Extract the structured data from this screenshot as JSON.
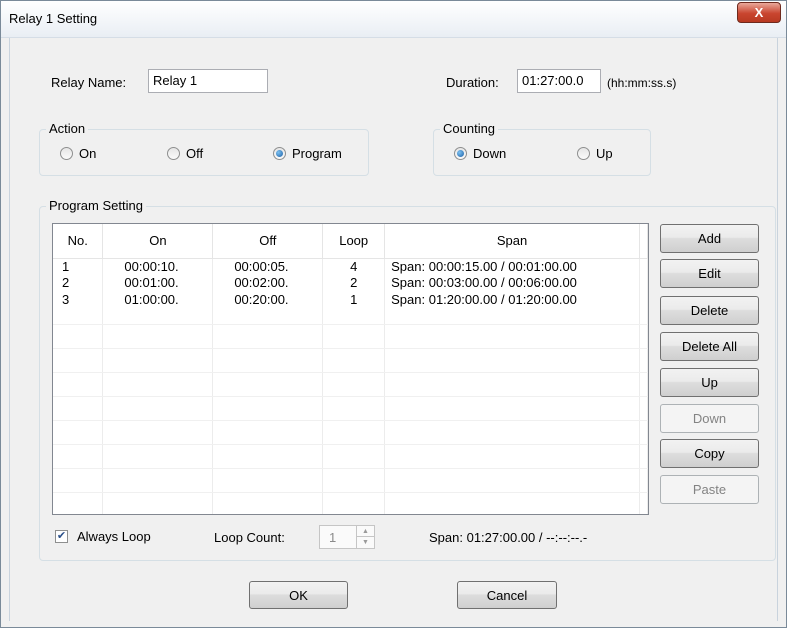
{
  "window": {
    "title": "Relay 1 Setting",
    "close_glyph": "X"
  },
  "relay_name": {
    "label": "Relay Name:",
    "value": "Relay 1"
  },
  "duration": {
    "label": "Duration:",
    "value": "01:27:00.0",
    "format": "(hh:mm:ss.s)"
  },
  "action": {
    "label": "Action",
    "options": [
      {
        "label": "On",
        "checked": false
      },
      {
        "label": "Off",
        "checked": false
      },
      {
        "label": "Program",
        "checked": true
      }
    ]
  },
  "counting": {
    "label": "Counting",
    "options": [
      {
        "label": "Down",
        "checked": true
      },
      {
        "label": "Up",
        "checked": false
      }
    ]
  },
  "program": {
    "label": "Program Setting",
    "columns": [
      "No.",
      "On",
      "Off",
      "Loop",
      "Span"
    ],
    "rows": [
      [
        "1",
        "00:00:10.",
        "00:00:05.",
        "4",
        "Span: 00:00:15.00 / 00:01:00.00"
      ],
      [
        "2",
        "00:01:00.",
        "00:02:00.",
        "2",
        "Span: 00:03:00.00 / 00:06:00.00"
      ],
      [
        "3",
        "01:00:00.",
        "00:20:00.",
        "1",
        "Span: 01:20:00.00 / 01:20:00.00"
      ]
    ],
    "buttons": {
      "add": "Add",
      "edit": "Edit",
      "delete": "Delete",
      "delete_all": "Delete All",
      "up": "Up",
      "down": "Down",
      "copy": "Copy",
      "paste": "Paste"
    }
  },
  "always_loop": {
    "label": "Always Loop",
    "checked": true
  },
  "loop_count": {
    "label": "Loop Count:",
    "value": "1"
  },
  "total_span": "Span: 01:27:00.00 / --:--:--.-",
  "footer": {
    "ok": "OK",
    "cancel": "Cancel"
  },
  "colors": {
    "title_bg": "#e9eef4",
    "close_red": "#c9452f",
    "radio_dot": "#1c5fa5"
  }
}
